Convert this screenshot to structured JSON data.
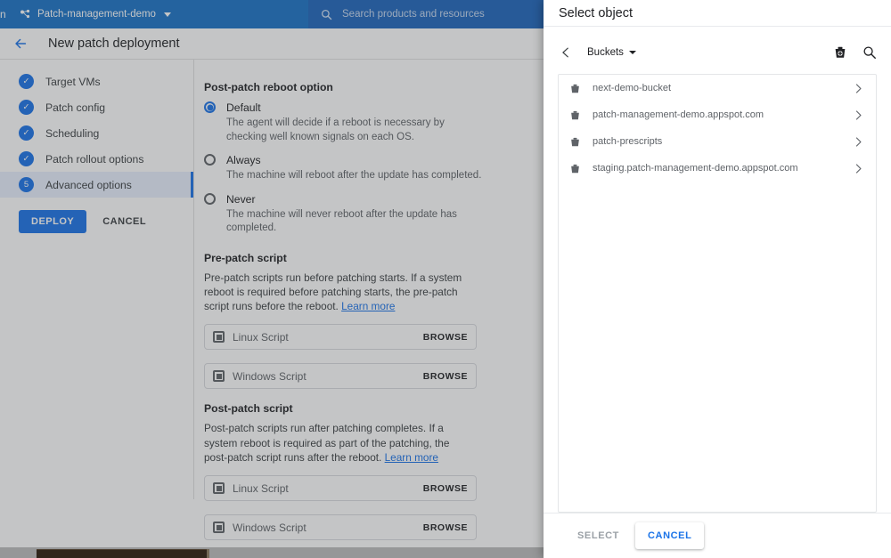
{
  "colors": {
    "gcp_blue": "#1a73c8",
    "accent_blue": "#1a73e8",
    "link_blue": "#1a73e8",
    "page_bg": "#ffffff",
    "muted_text": "#5f6368",
    "disabled_text": "#9aa0a6"
  },
  "topbar": {
    "logo_text": "n",
    "project_name": "Patch-management-demo",
    "project_icon": "project-nodes-icon",
    "project_caret_icon": "caret-down-icon",
    "search_icon": "search-icon",
    "search_placeholder": "Search products and resources",
    "search_value": ""
  },
  "pageheader": {
    "back_icon": "arrow-back-icon",
    "title": "New patch deployment"
  },
  "steps": {
    "items": [
      {
        "label": "Target VMs",
        "badge": "✓",
        "state": "complete"
      },
      {
        "label": "Patch config",
        "badge": "✓",
        "state": "complete"
      },
      {
        "label": "Scheduling",
        "badge": "✓",
        "state": "complete"
      },
      {
        "label": "Patch rollout options",
        "badge": "✓",
        "state": "complete"
      },
      {
        "label": "Advanced options",
        "badge": "5",
        "state": "active"
      }
    ],
    "deploy_label": "DEPLOY",
    "cancel_label": "CANCEL"
  },
  "form": {
    "reboot": {
      "title": "Post-patch reboot option",
      "options": [
        {
          "label": "Default",
          "help": "The agent will decide if a reboot is necessary by checking well known signals on each OS.",
          "selected": true
        },
        {
          "label": "Always",
          "help": "The machine will reboot after the update has completed.",
          "selected": false
        },
        {
          "label": "Never",
          "help": "The machine will never reboot after the update has completed.",
          "selected": false
        }
      ]
    },
    "prepatch": {
      "title": "Pre-patch script",
      "desc": "Pre-patch scripts run before patching starts. If a system reboot is required before patching starts, the pre-patch script runs before the reboot. ",
      "learn_more": "Learn more",
      "linux_placeholder": "Linux Script",
      "linux_value": "",
      "windows_placeholder": "Windows Script",
      "windows_value": "",
      "browse_label": "BROWSE",
      "field_icon": "script-file-icon"
    },
    "postpatch": {
      "title": "Post-patch script",
      "desc": "Post-patch scripts run after patching completes. If a system reboot is required as part of the patching, the post-patch script runs after the reboot. ",
      "learn_more": "Learn more",
      "linux_placeholder": "Linux Script",
      "linux_value": "",
      "windows_placeholder": "Windows Script",
      "windows_value": "",
      "browse_label": "BROWSE",
      "field_icon": "script-file-icon"
    }
  },
  "modal": {
    "title": "Select object",
    "back_icon": "chevron-left-icon",
    "breadcrumb_label": "Buckets",
    "breadcrumb_caret_icon": "caret-down-icon",
    "new_bucket_icon": "new-bucket-icon",
    "search_icon": "search-icon",
    "buckets": [
      {
        "name": "next-demo-bucket",
        "icon": "bucket-icon",
        "chevron": "chevron-right-icon"
      },
      {
        "name": "patch-management-demo.appspot.com",
        "icon": "bucket-icon",
        "chevron": "chevron-right-icon"
      },
      {
        "name": "patch-prescripts",
        "icon": "bucket-icon",
        "chevron": "chevron-right-icon"
      },
      {
        "name": "staging.patch-management-demo.appspot.com",
        "icon": "bucket-icon",
        "chevron": "chevron-right-icon"
      }
    ],
    "select_label": "SELECT",
    "select_disabled": true,
    "cancel_label": "CANCEL"
  }
}
